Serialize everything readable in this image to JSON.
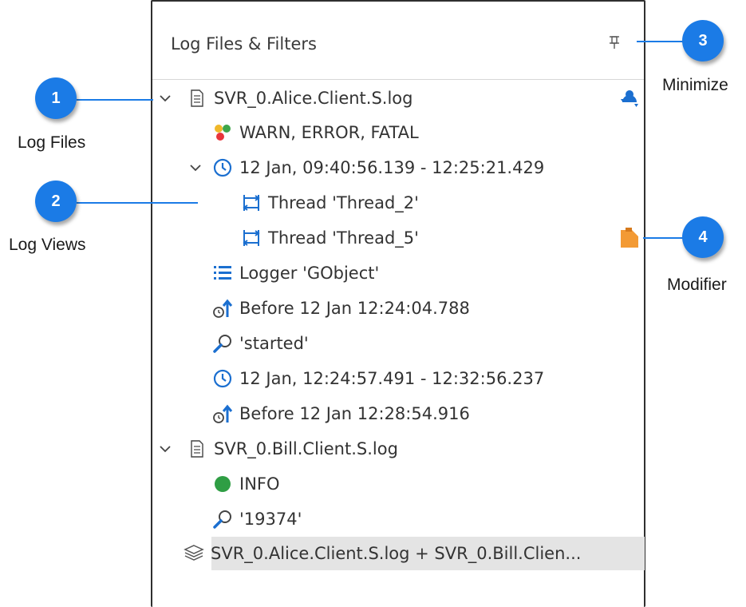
{
  "panel": {
    "title": "Log Files & Filters",
    "pin_icon": "pin-icon"
  },
  "tree": [
    {
      "id": "file1",
      "label": "SVR_0.Alice.Client.S.log",
      "icon": "document-icon",
      "expanded": true
    },
    {
      "id": "levels1",
      "label": "WARN, ERROR, FATAL",
      "icon": "level-dots-icon"
    },
    {
      "id": "range1",
      "label": "12 Jan, 09:40:56.139 - 12:25:21.429",
      "icon": "clock-icon",
      "expanded": true
    },
    {
      "id": "thread2",
      "label": "Thread 'Thread_2'",
      "icon": "thread-icon"
    },
    {
      "id": "thread5",
      "label": "Thread 'Thread_5'",
      "icon": "thread-icon"
    },
    {
      "id": "logger",
      "label": "Logger 'GObject'",
      "icon": "logger-icon"
    },
    {
      "id": "before1",
      "label": "Before 12 Jan 12:24:04.788",
      "icon": "before-time-icon"
    },
    {
      "id": "search1",
      "label": "'started'",
      "icon": "search-icon"
    },
    {
      "id": "range2",
      "label": "12 Jan, 12:24:57.491 - 12:32:56.237",
      "icon": "clock-icon"
    },
    {
      "id": "before2",
      "label": "Before 12 Jan 12:28:54.916",
      "icon": "before-time-icon"
    },
    {
      "id": "file2",
      "label": "SVR_0.Bill.Client.S.log",
      "icon": "document-icon",
      "expanded": true
    },
    {
      "id": "info",
      "label": "INFO",
      "icon": "green-dot-icon"
    },
    {
      "id": "search2",
      "label": "'19374'",
      "icon": "search-icon"
    },
    {
      "id": "merged",
      "label": "SVR_0.Alice.Client.S.log + SVR_0.Bill.Clien...",
      "icon": "layers-icon"
    }
  ],
  "callouts": {
    "c1": {
      "number": "1",
      "label": "Log Files"
    },
    "c2": {
      "number": "2",
      "label": "Log Views"
    },
    "c3": {
      "number": "3",
      "label": "Minimize"
    },
    "c4": {
      "number": "4",
      "label": "Modifier"
    }
  },
  "colors": {
    "accent": "#1b7be6",
    "warn_yellow": "#f0b82a",
    "error_red": "#e8353b",
    "fatal_green": "#3ea64a",
    "info_green": "#2f9e44",
    "modifier_orange": "#f39a34",
    "selection_gray": "#e4e4e4"
  }
}
